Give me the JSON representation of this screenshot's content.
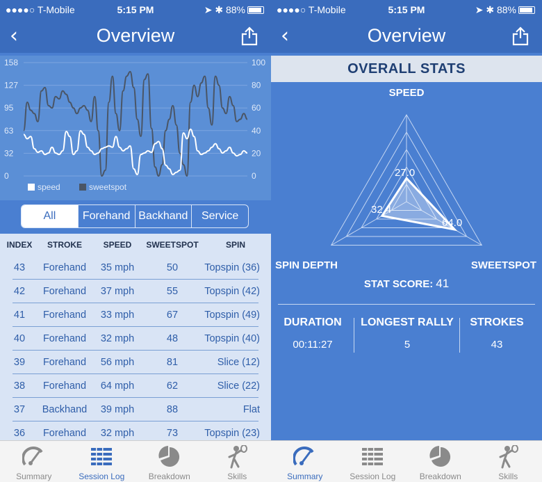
{
  "status": {
    "carrier": "●●●●○ T-Mobile",
    "time": "5:15 PM",
    "battery": "88%",
    "battery_level": 0.88
  },
  "left": {
    "nav_title": "Overview",
    "chart_data": {
      "type": "line",
      "y_left_ticks": [
        "158",
        "127",
        "95",
        "63",
        "32",
        "0"
      ],
      "y_right_ticks": [
        "100",
        "80",
        "60",
        "40",
        "20",
        "0"
      ],
      "ylim_left": [
        0,
        158
      ],
      "ylim_right": [
        0,
        100
      ],
      "series": [
        {
          "name": "speed",
          "color": "#ffffff",
          "axis": "left",
          "values": [
            58,
            52,
            55,
            38,
            33,
            35,
            30,
            32,
            40,
            32,
            30,
            35,
            62,
            55,
            30,
            35,
            63,
            58,
            40,
            35,
            30,
            32,
            38,
            40,
            42,
            40,
            55,
            40,
            35,
            38,
            42,
            10,
            2,
            30,
            32,
            35,
            33,
            45,
            48,
            38,
            15,
            10,
            2,
            5,
            8,
            60,
            52,
            65,
            55,
            35,
            30,
            32,
            35,
            40,
            45,
            38,
            32,
            35,
            40,
            32,
            28,
            30,
            35,
            32
          ]
        },
        {
          "name": "sweetspot",
          "color": "#4a5565",
          "axis": "right",
          "values": [
            40,
            65,
            58,
            55,
            48,
            75,
            78,
            62,
            60,
            70,
            68,
            75,
            72,
            65,
            60,
            55,
            60,
            62,
            58,
            48,
            70,
            40,
            0,
            5,
            65,
            88,
            55,
            40,
            75,
            88,
            92,
            78,
            50,
            35,
            85,
            90,
            42,
            8,
            0,
            10,
            40,
            50,
            62,
            45,
            20,
            10,
            0,
            65,
            80,
            70,
            82,
            88,
            60,
            45,
            88,
            80,
            60,
            55,
            70,
            62,
            48,
            50,
            55,
            50
          ]
        }
      ]
    },
    "filters": [
      "All",
      "Forehand",
      "Backhand",
      "Service"
    ],
    "active_filter": 0,
    "columns": [
      "INDEX",
      "STROKE",
      "SPEED",
      "SWEETSPOT",
      "SPIN"
    ],
    "rows": [
      [
        "43",
        "Forehand",
        "35 mph",
        "50",
        "Topspin (36)"
      ],
      [
        "42",
        "Forehand",
        "37 mph",
        "55",
        "Topspin (42)"
      ],
      [
        "41",
        "Forehand",
        "33 mph",
        "67",
        "Topspin (49)"
      ],
      [
        "40",
        "Forehand",
        "32 mph",
        "48",
        "Topspin (40)"
      ],
      [
        "39",
        "Forehand",
        "56 mph",
        "81",
        "Slice (12)"
      ],
      [
        "38",
        "Forehand",
        "64 mph",
        "62",
        "Slice (22)"
      ],
      [
        "37",
        "Backhand",
        "39 mph",
        "88",
        "Flat"
      ],
      [
        "36",
        "Forehand",
        "32 mph",
        "73",
        "Topspin (23)"
      ]
    ],
    "active_tab": 1
  },
  "right": {
    "nav_title": "Overview",
    "header": "OVERALL STATS",
    "radar": {
      "axes": [
        "SPEED",
        "SWEETSPOT",
        "SPIN DEPTH"
      ],
      "values": [
        27.0,
        64.0,
        32.4
      ],
      "value_labels": [
        "27.0",
        "64.0",
        "32.4"
      ],
      "max": 100
    },
    "score_label": "STAT SCORE:",
    "score_value": "41",
    "summary": [
      {
        "label": "DURATION",
        "value": "00:11:27"
      },
      {
        "label": "LONGEST RALLY",
        "value": "5"
      },
      {
        "label": "STROKES",
        "value": "43"
      }
    ],
    "active_tab": 0
  },
  "tabs": [
    "Summary",
    "Session Log",
    "Breakdown",
    "Skills"
  ],
  "tab_icons": [
    "gauge-icon",
    "list-icon",
    "pie-chart-icon",
    "player-icon"
  ],
  "colors": {
    "primary": "#3a6cbd",
    "background": "#4a7fd1",
    "table_bg": "#d9e4f5",
    "tab_inactive": "#8a8a8a"
  }
}
